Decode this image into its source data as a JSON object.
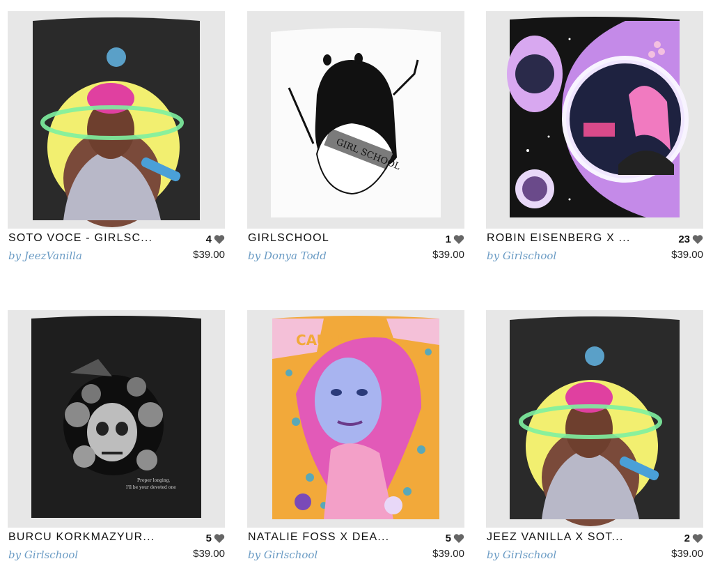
{
  "products": [
    {
      "title": "SOTO VOCE - GIRLSC...",
      "likes": "4",
      "artist": "by JeezVanilla",
      "price": "$39.00",
      "icon": "heart-icon"
    },
    {
      "title": "GIRLSCHOOL",
      "likes": "1",
      "artist": "by Donya Todd",
      "price": "$39.00",
      "icon": "heart-icon"
    },
    {
      "title": "ROBIN EISENBERG X ...",
      "likes": "23",
      "artist": "by Girlschool",
      "price": "$39.00",
      "icon": "heart-icon"
    },
    {
      "title": "BURCU KORKMAZYUR...",
      "likes": "5",
      "artist": "by Girlschool",
      "price": "$39.00",
      "icon": "heart-icon"
    },
    {
      "title": "NATALIE FOSS X DEA...",
      "likes": "5",
      "artist": "by Girlschool",
      "price": "$39.00",
      "icon": "heart-icon"
    },
    {
      "title": "JEEZ VANILLA X SOT...",
      "likes": "2",
      "artist": "by Girlschool",
      "price": "$39.00",
      "icon": "heart-icon"
    }
  ],
  "artwork_text": {
    "girlschool_sash": "GIRL SCHOOL",
    "burcu_caption_line1": "Proper longing,",
    "burcu_caption_line2": "I'll be your devoted one",
    "natalie_banner": "CAUSE"
  },
  "colors": {
    "artist_link": "#6a9bc4",
    "thumb_bg": "#e7e7e7",
    "heart": "#666666"
  }
}
